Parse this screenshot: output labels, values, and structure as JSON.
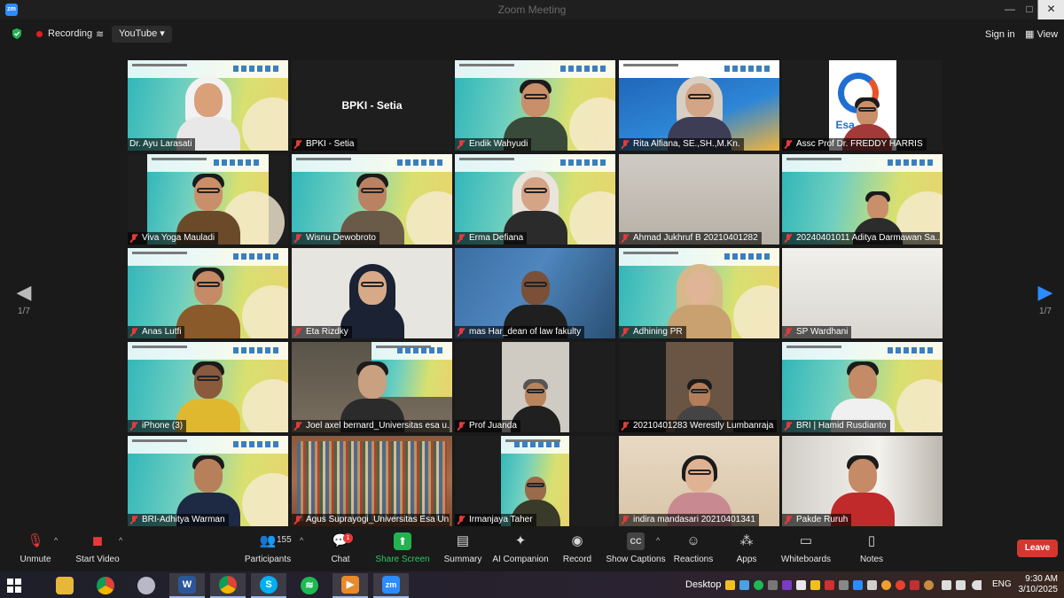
{
  "window": {
    "title": "Zoom Meeting",
    "minimize": "—",
    "maximize": "□",
    "close": "✕"
  },
  "topbar": {
    "recording_label": "Recording",
    "stream_label": "YouTube",
    "signin_label": "Sign in",
    "view_label": "View"
  },
  "pager": {
    "left_page": "1/7",
    "right_page": "1/7"
  },
  "tiles": [
    {
      "name": "Dr. Ayu Larasati",
      "active": true
    },
    {
      "name": "BPKI - Setia",
      "center_label": "BPKI - Setia"
    },
    {
      "name": "Endik Wahyudi"
    },
    {
      "name": "Rita Alfiana, SE.,SH.,M.Kn."
    },
    {
      "name": "Assc Prof Dr. FREDDY HARRIS",
      "logo_text": "Esa"
    },
    {
      "name": "Viva Yoga Mauladi"
    },
    {
      "name": "Wisnu Dewobroto"
    },
    {
      "name": "Erma Defiana"
    },
    {
      "name": "Ahmad Jukhruf B 20210401282"
    },
    {
      "name": "20240401011 Aditya Darmawan Sa..."
    },
    {
      "name": "Anas Lutfi"
    },
    {
      "name": "Eta Rizdky"
    },
    {
      "name": "mas Har_dean of law fakulty"
    },
    {
      "name": "Adhining PR"
    },
    {
      "name": "SP Wardhani"
    },
    {
      "name": "iPhone (3)"
    },
    {
      "name": "Joel axel bernard_Universitas esa u..."
    },
    {
      "name": "Prof Juanda"
    },
    {
      "name": "20210401283 Werestly Lumbanraja"
    },
    {
      "name": "BRI | Hamid Rusdianto"
    },
    {
      "name": "BRI-Adhitya Warman"
    },
    {
      "name": "Agus Suprayogi_Universitas Esa Un..."
    },
    {
      "name": "Irmanjaya Taher"
    },
    {
      "name": "indira mandasari 20210401341"
    },
    {
      "name": "Pakde Ruruh"
    }
  ],
  "toolbar": {
    "unmute": "Unmute",
    "start_video": "Start Video",
    "participants": "Participants",
    "participants_count": "155",
    "chat": "Chat",
    "chat_badge": "1",
    "share_screen": "Share Screen",
    "summary": "Summary",
    "ai_companion": "AI Companion",
    "record": "Record",
    "show_captions": "Show Captions",
    "captions_icon_text": "CC",
    "reactions": "Reactions",
    "apps": "Apps",
    "whiteboards": "Whiteboards",
    "notes": "Notes",
    "leave": "Leave"
  },
  "taskbar": {
    "desktop_label": "Desktop",
    "language": "ENG",
    "time": "9:30 AM",
    "date": "3/10/2025",
    "zoom_app_text": "zm",
    "word_app_text": "W"
  },
  "colors": {
    "active_speaker": "#c8e05a",
    "recording": "#e02020",
    "share": "#23b24f",
    "leave": "#d43730"
  }
}
